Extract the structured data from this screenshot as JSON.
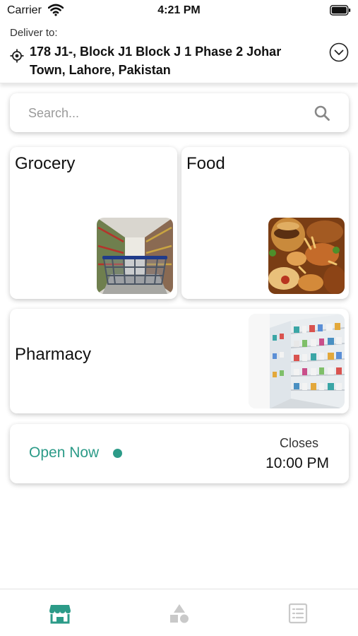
{
  "status_bar": {
    "carrier": "Carrier",
    "time": "4:21 PM"
  },
  "delivery": {
    "label": "Deliver to:",
    "address": "178 J1-, Block J1 Block J 1 Phase 2 Johar Town, Lahore, Pakistan"
  },
  "search": {
    "placeholder": "Search..."
  },
  "categories": [
    {
      "title": "Grocery",
      "image": "shopping-cart-supermarket-aisle"
    },
    {
      "title": "Food",
      "image": "fast-food-platter"
    },
    {
      "title": "Pharmacy",
      "image": "pharmacy-shelves"
    }
  ],
  "store_hours": {
    "status": "Open Now",
    "closes_label": "Closes",
    "closes_time": "10:00 PM"
  },
  "tabs": [
    {
      "icon": "store-icon",
      "active": true
    },
    {
      "icon": "categories-icon",
      "active": false
    },
    {
      "icon": "orders-list-icon",
      "active": false
    }
  ],
  "colors": {
    "accent": "#2c9b88",
    "inactive_icon": "#c9c9c9",
    "text": "#111111"
  }
}
